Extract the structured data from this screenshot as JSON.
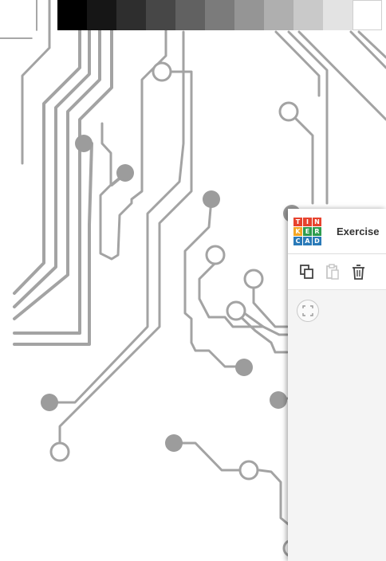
{
  "tinkercad": {
    "logo_letters": [
      "T",
      "I",
      "N",
      "K",
      "E",
      "R",
      "C",
      "A",
      "D"
    ],
    "logo_colors": [
      "#e7432e",
      "#e7432e",
      "#e7432e",
      "#f5a623",
      "#2d9c4e",
      "#2d9c4e",
      "#2a7ab8",
      "#2a7ab8",
      "#2a7ab8"
    ],
    "title": "Exercise",
    "toolbar": {
      "copy_icon": "copy-icon",
      "paste_icon": "paste-icon",
      "delete_icon": "trash-icon"
    },
    "view_controls": {
      "fit_icon": "fit-view-icon"
    }
  },
  "swatch_colors": [
    "#000000",
    "#161616",
    "#2e2e2e",
    "#474747",
    "#616161",
    "#7b7b7b",
    "#959595",
    "#afafaf",
    "#c9c9c9",
    "#e3e3e3",
    "#ffffff"
  ]
}
